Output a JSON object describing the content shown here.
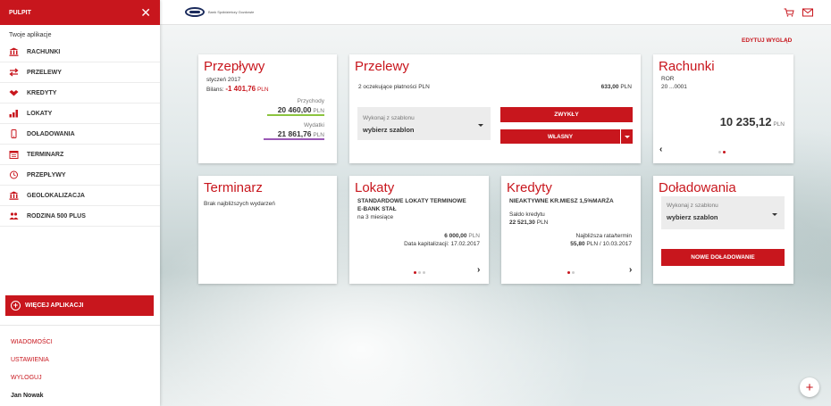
{
  "sidebar": {
    "header_title": "PULPIT",
    "subtitle": "Twoje aplikacje",
    "items": [
      {
        "label": "RACHUNKI",
        "icon": "bank-icon"
      },
      {
        "label": "PRZELEWY",
        "icon": "transfer-icon"
      },
      {
        "label": "KREDYTY",
        "icon": "handshake-icon"
      },
      {
        "label": "LOKATY",
        "icon": "bar-chart-icon"
      },
      {
        "label": "DOŁADOWANIA",
        "icon": "phone-icon"
      },
      {
        "label": "TERMINARZ",
        "icon": "calendar-icon"
      },
      {
        "label": "PRZEPŁYWY",
        "icon": "clock-icon"
      },
      {
        "label": "GEOLOKALIZACJA",
        "icon": "bank-icon"
      },
      {
        "label": "RODZINA 500 PLUS",
        "icon": "people-icon"
      }
    ],
    "more_button": "WIĘCEJ APLIKACJI",
    "footer_links": [
      "WIADOMOŚCI",
      "USTAWIENIA",
      "WYLOGUJ"
    ],
    "user_name": "Jan Nowak"
  },
  "topbar": {
    "logo_text": "Bank Spółdzielczy Gozdowie"
  },
  "edit_view": "EDYTUJ WYGLĄD",
  "przeplywy": {
    "title": "Przepływy",
    "period": "styczeń 2017",
    "balance_label": "Bilans:",
    "balance_value": "-1 401,76",
    "currency": "PLN",
    "income_label": "Przychody",
    "income_value": "20 460,00",
    "expense_label": "Wydatki",
    "expense_value": "21 861,76"
  },
  "przelewy": {
    "title": "Przelewy",
    "pending": "2 oczekujące płatności PLN",
    "pending_amount": "633,00",
    "currency": "PLN",
    "template_label": "Wykonaj z szablonu",
    "template_value": "wybierz szablon",
    "btn_normal": "ZWYKŁY",
    "btn_own": "WŁASNY"
  },
  "rachunki": {
    "title": "Rachunki",
    "account_type": "ROR",
    "account_number": "20 ...0001",
    "balance": "10 235,12",
    "currency": "PLN"
  },
  "terminarz": {
    "title": "Terminarz",
    "empty": "Brak najbliższych wydarzeń"
  },
  "lokaty": {
    "title": "Lokaty",
    "name_line1": "STANDARDOWE LOKATY TERMINOWE",
    "name_line2": "E-BANK STAŁ",
    "duration": "na 3 miesiące",
    "amount": "6 000,00",
    "currency": "PLN",
    "cap_date": "Data kapitalizacji: 17.02.2017"
  },
  "kredyty": {
    "title": "Kredyty",
    "name": "NIEAKTYWNE KR.MIESZ 1,5%MARŻA",
    "balance_label": "Saldo kredytu",
    "balance_value": "22 521,30",
    "currency": "PLN",
    "next_label": "Najbliższa rata/termin",
    "next_amount": "55,80",
    "next_rest": "PLN / 10.03.2017"
  },
  "doladowania": {
    "title": "Doładowania",
    "template_label": "Wykonaj z szablonu",
    "template_value": "wybierz szablon",
    "btn_new": "NOWE DOŁADOWANIE"
  },
  "colors": {
    "brand_red": "#c8161d",
    "income_bar": "#8cc43f",
    "expense_bar": "#9b59b6"
  }
}
